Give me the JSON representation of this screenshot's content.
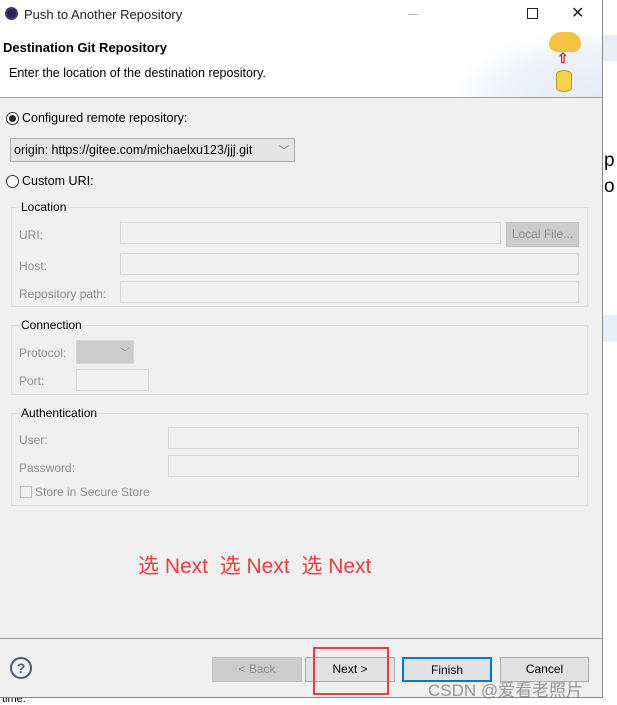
{
  "window": {
    "title": "Push to Another Repository"
  },
  "header": {
    "title": "Destination Git Repository",
    "description": "Enter the location of the destination repository."
  },
  "configured": {
    "label": "Configured remote repository:",
    "selected": true,
    "value": "origin: https://gitee.com/michaelxu123/jjj.git"
  },
  "custom": {
    "label": "Custom URI:",
    "selected": false
  },
  "location": {
    "title": "Location",
    "uri_label": "URI:",
    "local_file": "Local File...",
    "host_label": "Host:",
    "path_label": "Repository path:"
  },
  "connection": {
    "title": "Connection",
    "protocol_label": "Protocol:",
    "port_label": "Port:"
  },
  "auth": {
    "title": "Authentication",
    "user_label": "User:",
    "password_label": "Password:",
    "store_label": "Store in Secure Store"
  },
  "annotation": "选 Next  选 Next  选 Next",
  "buttons": {
    "back": "< Back",
    "next": "Next >",
    "finish": "Finish",
    "cancel": "Cancel"
  },
  "background": {
    "line1": "p",
    "line2": "o",
    "footer": "time."
  },
  "watermark": "CSDN @爱看老照片",
  "colors": {
    "annotation": "#f03c3c",
    "focus": "#0078d7"
  }
}
